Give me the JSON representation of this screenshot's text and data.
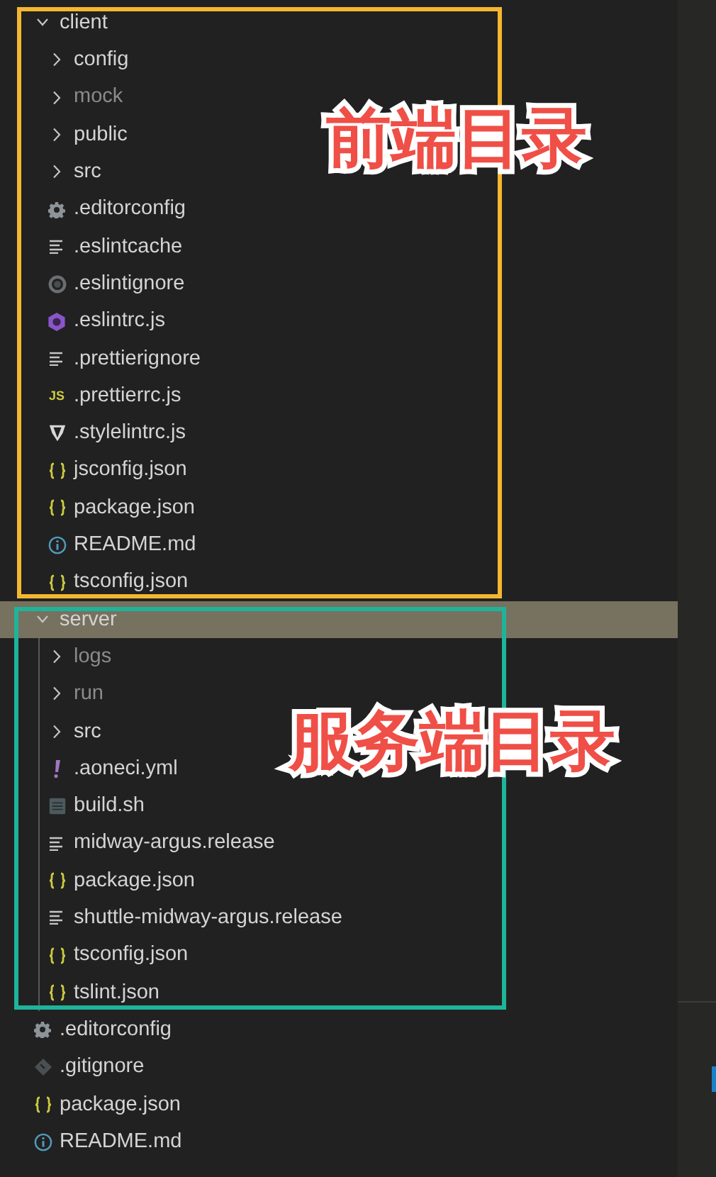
{
  "tree": [
    {
      "name": "client",
      "kind": "folder",
      "expanded": true,
      "selected": false,
      "dimmed": false,
      "children": [
        {
          "name": "config",
          "kind": "folder",
          "expanded": false,
          "selected": false,
          "dimmed": false
        },
        {
          "name": "mock",
          "kind": "folder",
          "expanded": false,
          "selected": false,
          "dimmed": true
        },
        {
          "name": "public",
          "kind": "folder",
          "expanded": false,
          "selected": false,
          "dimmed": false
        },
        {
          "name": "src",
          "kind": "folder",
          "expanded": false,
          "selected": false,
          "dimmed": false
        },
        {
          "name": ".editorconfig",
          "kind": "settings",
          "selected": false,
          "dimmed": false
        },
        {
          "name": ".eslintcache",
          "kind": "text",
          "selected": false,
          "dimmed": false
        },
        {
          "name": ".eslintignore",
          "kind": "ignore",
          "selected": false,
          "dimmed": false
        },
        {
          "name": ".eslintrc.js",
          "kind": "eslint",
          "selected": false,
          "dimmed": false
        },
        {
          "name": ".prettierignore",
          "kind": "text",
          "selected": false,
          "dimmed": false
        },
        {
          "name": ".prettierrc.js",
          "kind": "js",
          "icon_text": "JS",
          "selected": false,
          "dimmed": false
        },
        {
          "name": ".stylelintrc.js",
          "kind": "stylelint",
          "selected": false,
          "dimmed": false
        },
        {
          "name": "jsconfig.json",
          "kind": "json",
          "selected": false,
          "dimmed": false
        },
        {
          "name": "package.json",
          "kind": "json",
          "selected": false,
          "dimmed": false
        },
        {
          "name": "README.md",
          "kind": "info",
          "selected": false,
          "dimmed": false
        },
        {
          "name": "tsconfig.json",
          "kind": "json",
          "selected": false,
          "dimmed": false
        }
      ]
    },
    {
      "name": "server",
      "kind": "folder",
      "expanded": true,
      "selected": true,
      "dimmed": false,
      "children": [
        {
          "name": "logs",
          "kind": "folder",
          "expanded": false,
          "selected": false,
          "dimmed": true
        },
        {
          "name": "run",
          "kind": "folder",
          "expanded": false,
          "selected": false,
          "dimmed": true
        },
        {
          "name": "src",
          "kind": "folder",
          "expanded": false,
          "selected": false,
          "dimmed": false
        },
        {
          "name": ".aoneci.yml",
          "kind": "yaml",
          "selected": false,
          "dimmed": false
        },
        {
          "name": "build.sh",
          "kind": "shell",
          "selected": false,
          "dimmed": false
        },
        {
          "name": "midway-argus.release",
          "kind": "text",
          "selected": false,
          "dimmed": false
        },
        {
          "name": "package.json",
          "kind": "json",
          "selected": false,
          "dimmed": false
        },
        {
          "name": "shuttle-midway-argus.release",
          "kind": "text",
          "selected": false,
          "dimmed": false
        },
        {
          "name": "tsconfig.json",
          "kind": "json",
          "selected": false,
          "dimmed": false
        },
        {
          "name": "tslint.json",
          "kind": "json",
          "selected": false,
          "dimmed": false
        }
      ]
    },
    {
      "name": ".editorconfig",
      "kind": "settings",
      "selected": false,
      "dimmed": false
    },
    {
      "name": ".gitignore",
      "kind": "git",
      "selected": false,
      "dimmed": false
    },
    {
      "name": "package.json",
      "kind": "json",
      "selected": false,
      "dimmed": false
    },
    {
      "name": "README.md",
      "kind": "info",
      "selected": false,
      "dimmed": false
    }
  ],
  "annotations": [
    {
      "label": "前端目录",
      "color": "#f5b731"
    },
    {
      "label": "服务端目录",
      "color": "#1fb39a"
    }
  ]
}
